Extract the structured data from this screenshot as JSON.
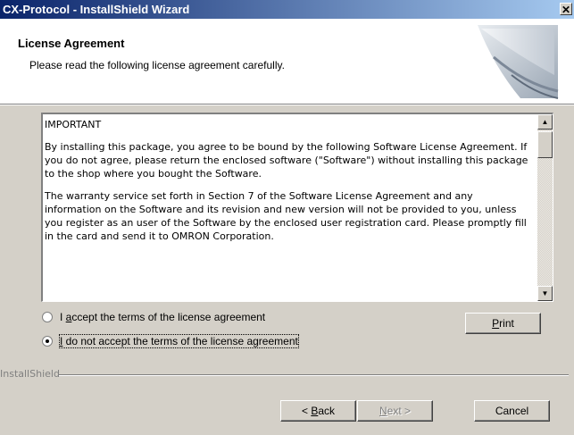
{
  "window": {
    "title": "CX-Protocol - InstallShield Wizard",
    "close_glyph": "✕"
  },
  "header": {
    "title": "License Agreement",
    "subtitle": "Please read the following license agreement carefully."
  },
  "license": {
    "paragraphs": [
      "IMPORTANT",
      "By installing this package, you agree to be bound by the following Software License Agreement. If you do not agree, please return the enclosed software (\"Software\") without installing this package to the shop where you bought the Software.",
      "The warranty service set forth in Section 7 of the Software License Agreement and any information on the Software and its revision and new version will not be provided to you, unless you register as an user of the Software by the enclosed user registration card. Please promptly fill in the card and send it to OMRON Corporation."
    ],
    "scroll_up_glyph": "▲",
    "scroll_down_glyph": "▼"
  },
  "options": {
    "accept": {
      "prefix": "I ",
      "mnemonic": "a",
      "rest": "ccept the terms of the license agreement",
      "selected": false
    },
    "decline": {
      "prefix": "",
      "mnemonic": "I",
      "rest": " do not accept the terms of the license agreement",
      "selected": true
    }
  },
  "buttons": {
    "print": {
      "mnemonic": "P",
      "rest": "rint"
    },
    "back": {
      "prefix": "< ",
      "mnemonic": "B",
      "rest": "ack"
    },
    "next": {
      "prefix": "",
      "mnemonic": "N",
      "rest": "ext >",
      "enabled": false
    },
    "cancel": {
      "label": "Cancel"
    }
  },
  "footer": {
    "brand": "InstallShield"
  },
  "icons": {
    "close": "close-icon",
    "header_graphic": "monitor-swoosh-icon",
    "scroll_up": "scroll-up-arrow-icon",
    "scroll_down": "scroll-down-arrow-icon"
  }
}
